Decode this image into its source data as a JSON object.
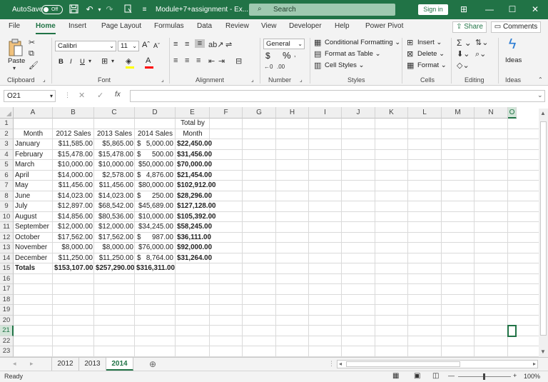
{
  "titlebar": {
    "autosave_label": "AutoSave",
    "autosave_state": "Off",
    "doc_title": "Module+7+assignment - Ex...",
    "search_placeholder": "Search",
    "signin_label": "Sign in"
  },
  "menu_tabs": [
    "File",
    "Home",
    "Insert",
    "Page Layout",
    "Formulas",
    "Data",
    "Review",
    "View",
    "Developer",
    "Help",
    "Power Pivot"
  ],
  "active_tab": "Home",
  "share_label": "Share",
  "comments_label": "Comments",
  "ribbon": {
    "clipboard": {
      "label": "Clipboard",
      "paste": "Paste"
    },
    "font": {
      "label": "Font",
      "name": "Calibri",
      "size": "11",
      "grow": "A",
      "shrink": "A",
      "bold": "B",
      "italic": "I",
      "underline": "U"
    },
    "alignment": {
      "label": "Alignment"
    },
    "number": {
      "label": "Number",
      "format": "General",
      "currency": "$",
      "percent": "%"
    },
    "styles": {
      "label": "Styles",
      "conditional": "Conditional Formatting",
      "table": "Format as Table",
      "cell_styles": "Cell Styles"
    },
    "cells": {
      "label": "Cells",
      "insert": "Insert",
      "delete": "Delete",
      "format": "Format"
    },
    "editing": {
      "label": "Editing"
    },
    "ideas": {
      "label": "Ideas",
      "button": "Ideas"
    }
  },
  "formula_bar": {
    "name_box": "O21",
    "fx": "fx",
    "content": ""
  },
  "columns": [
    "A",
    "B",
    "C",
    "D",
    "E",
    "F",
    "G",
    "H",
    "I",
    "J",
    "K",
    "L",
    "M",
    "N",
    "O"
  ],
  "selected_column": "O",
  "selected_row": 21,
  "rows": [
    1,
    2,
    3,
    4,
    5,
    6,
    7,
    8,
    9,
    10,
    11,
    12,
    13,
    14,
    15,
    16,
    17,
    18,
    19,
    20,
    21,
    22,
    23
  ],
  "header_row": {
    "e1": "Total by",
    "a2": "Month",
    "b2": "2012 Sales",
    "c2": "2013 Sales",
    "d2": "2014 Sales",
    "e2": "Month"
  },
  "data_rows": [
    {
      "month": "January",
      "s2012": "$11,585.00",
      "s2013": "$5,865.00",
      "s2014_sym": "$",
      "s2014": "5,000.00",
      "total": "$22,450.00"
    },
    {
      "month": "February",
      "s2012": "$15,478.00",
      "s2013": "$15,478.00",
      "s2014_sym": "$",
      "s2014": "500.00",
      "total": "$31,456.00"
    },
    {
      "month": "March",
      "s2012": "$10,000.00",
      "s2013": "$10,000.00",
      "s2014_sym": "",
      "s2014": "$50,000.00",
      "total": "$70,000.00"
    },
    {
      "month": "April",
      "s2012": "$14,000.00",
      "s2013": "$2,578.00",
      "s2014_sym": "$",
      "s2014": "4,876.00",
      "total": "$21,454.00"
    },
    {
      "month": "May",
      "s2012": "$11,456.00",
      "s2013": "$11,456.00",
      "s2014_sym": "",
      "s2014": "$80,000.00",
      "total": "$102,912.00"
    },
    {
      "month": "June",
      "s2012": "$14,023.00",
      "s2013": "$14,023.00",
      "s2014_sym": "$",
      "s2014": "250.00",
      "total": "$28,296.00"
    },
    {
      "month": "July",
      "s2012": "$12,897.00",
      "s2013": "$68,542.00",
      "s2014_sym": "",
      "s2014": "$45,689.00",
      "total": "$127,128.00"
    },
    {
      "month": "August",
      "s2012": "$14,856.00",
      "s2013": "$80,536.00",
      "s2014_sym": "",
      "s2014": "$10,000.00",
      "total": "$105,392.00"
    },
    {
      "month": "September",
      "s2012": "$12,000.00",
      "s2013": "$12,000.00",
      "s2014_sym": "",
      "s2014": "$34,245.00",
      "total": "$58,245.00"
    },
    {
      "month": "October",
      "s2012": "$17,562.00",
      "s2013": "$17,562.00",
      "s2014_sym": "$",
      "s2014": "987.00",
      "total": "$36,111.00"
    },
    {
      "month": "November",
      "s2012": "$8,000.00",
      "s2013": "$8,000.00",
      "s2014_sym": "",
      "s2014": "$76,000.00",
      "total": "$92,000.00"
    },
    {
      "month": "December",
      "s2012": "$11,250.00",
      "s2013": "$11,250.00",
      "s2014_sym": "$",
      "s2014": "8,764.00",
      "total": "$31,264.00"
    }
  ],
  "totals_row": {
    "label": "Totals",
    "s2012": "$153,107.00",
    "s2013": "$257,290.00",
    "s2014": "$316,311.00"
  },
  "sheet_tabs": [
    "2012",
    "2013",
    "2014"
  ],
  "active_sheet": "2014",
  "status": {
    "ready": "Ready",
    "zoom": "100%"
  },
  "accent_color": "#217346"
}
